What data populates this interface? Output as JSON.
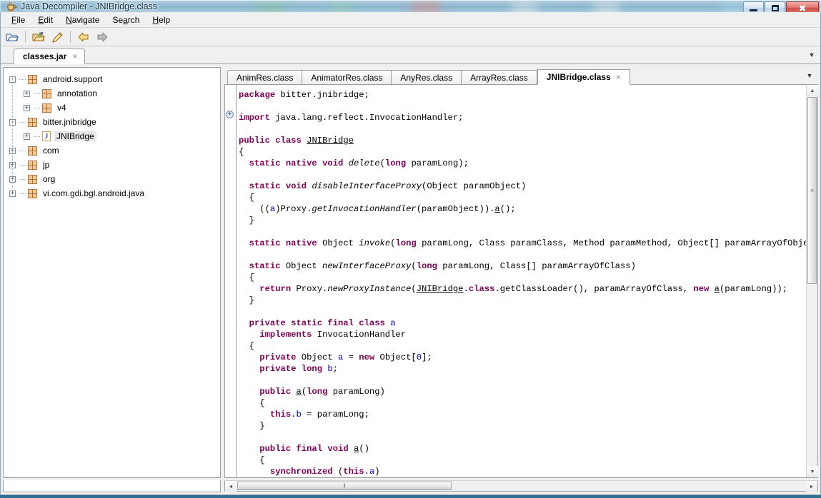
{
  "window": {
    "title": "Java Decompiler - JNIBridge.class",
    "app_icon": "java-coffee-cup-icon",
    "minimize_label": "Minimize",
    "maximize_label": "Maximize",
    "close_label": "Close"
  },
  "menubar": {
    "items": [
      {
        "label": "File",
        "mnemonic": "F"
      },
      {
        "label": "Edit",
        "mnemonic": "E"
      },
      {
        "label": "Navigate",
        "mnemonic": "N"
      },
      {
        "label": "Search",
        "mnemonic": "a"
      },
      {
        "label": "Help",
        "mnemonic": "H"
      }
    ]
  },
  "toolbar": {
    "buttons": [
      {
        "name": "open-file-icon",
        "tooltip": "Open File"
      },
      {
        "name": "open-folder-icon",
        "tooltip": "Open Recent"
      },
      {
        "name": "save-all-icon",
        "tooltip": "Save"
      },
      {
        "name": "back-arrow-icon",
        "tooltip": "Back"
      },
      {
        "name": "forward-arrow-icon",
        "tooltip": "Forward"
      }
    ]
  },
  "jar_tabs": {
    "tabs": [
      {
        "label": "classes.jar",
        "close": "×",
        "active": true
      }
    ],
    "overflow_glyph": "▼"
  },
  "tree": {
    "nodes": [
      {
        "label": "android.support",
        "indent": 0,
        "toggle": "-",
        "icon": "package-icon",
        "selected": false
      },
      {
        "label": "annotation",
        "indent": 1,
        "toggle": "+",
        "icon": "package-icon",
        "selected": false
      },
      {
        "label": "v4",
        "indent": 1,
        "toggle": "+",
        "icon": "package-icon",
        "selected": false
      },
      {
        "label": "bitter.jnibridge",
        "indent": 0,
        "toggle": "-",
        "icon": "package-icon",
        "selected": false
      },
      {
        "label": "JNIBridge",
        "indent": 1,
        "toggle": "+",
        "icon": "class-icon",
        "selected": true
      },
      {
        "label": "com",
        "indent": 0,
        "toggle": "+",
        "icon": "package-icon",
        "selected": false
      },
      {
        "label": "jp",
        "indent": 0,
        "toggle": "+",
        "icon": "package-icon",
        "selected": false
      },
      {
        "label": "org",
        "indent": 0,
        "toggle": "+",
        "icon": "package-icon",
        "selected": false
      },
      {
        "label": "vi.com.gdi.bgl.android.java",
        "indent": 0,
        "toggle": "+",
        "icon": "package-icon",
        "selected": false
      }
    ],
    "class_icon_letter": "J"
  },
  "editor_tabs": {
    "tabs": [
      {
        "label": "AnimRes.class",
        "active": false
      },
      {
        "label": "AnimatorRes.class",
        "active": false
      },
      {
        "label": "AnyRes.class",
        "active": false
      },
      {
        "label": "ArrayRes.class",
        "active": false
      },
      {
        "label": "JNIBridge.class",
        "active": true,
        "close": "×"
      }
    ],
    "overflow_glyph": "▼"
  },
  "editor": {
    "fold_marker": "+",
    "code_lines": [
      "package bitter.jnibridge;",
      "",
      "import java.lang.reflect.InvocationHandler;",
      "",
      "public class JNIBridge",
      "{",
      "  static native void delete(long paramLong);",
      "",
      "  static void disableInterfaceProxy(Object paramObject)",
      "  {",
      "    ((a)Proxy.getInvocationHandler(paramObject)).a();",
      "  }",
      "",
      "  static native Object invoke(long paramLong, Class paramClass, Method paramMethod, Object[] paramArrayOfObject);",
      "",
      "  static Object newInterfaceProxy(long paramLong, Class[] paramArrayOfClass)",
      "  {",
      "    return Proxy.newProxyInstance(JNIBridge.class.getClassLoader(), paramArrayOfClass, new a(paramLong));",
      "  }",
      "",
      "  private static final class a",
      "    implements InvocationHandler",
      "  {",
      "    private Object a = new Object[0];",
      "    private long b;",
      "",
      "    public a(long paramLong)",
      "    {",
      "      this.b = paramLong;",
      "    }",
      "",
      "    public final void a()",
      "    {",
      "      synchronized (this.a)"
    ]
  },
  "scrollbars": {
    "vertical": {
      "up_glyph": "▲",
      "down_glyph": "▼",
      "grip": "≡"
    },
    "horizontal": {
      "left_glyph": "◄",
      "right_glyph": "►",
      "grip": "‖"
    }
  },
  "colors": {
    "keyword": "#7f0055",
    "field": "#0000c0",
    "number": "#0000c0",
    "selection": "#e8e8e8",
    "titlebar_glass": "#bad6e9",
    "close_button": "#cf4b43",
    "package_icon": "#f4c99a"
  }
}
